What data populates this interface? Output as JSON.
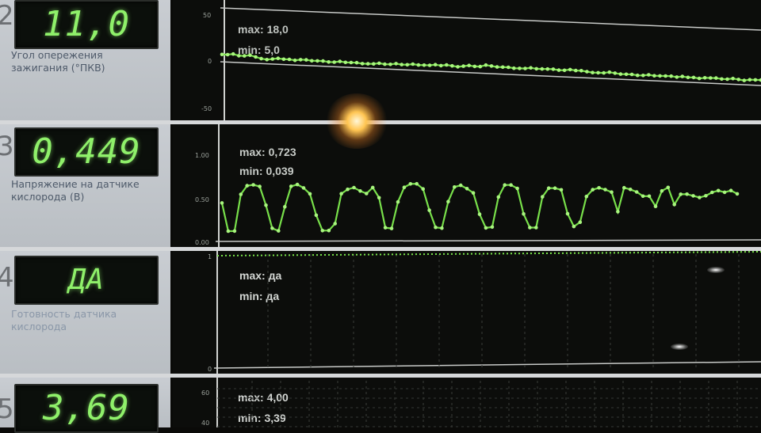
{
  "colors": {
    "trace": "#78e04a",
    "lcd": "#8ff06a",
    "panel_bg": "#0c0d0b",
    "sidebar_bg": "#c3c7cc"
  },
  "rows": [
    {
      "number": "2",
      "lcd_value": "11,0",
      "label_line1": "Угол опережения",
      "label_line2": "зажигания (°ПКВ)",
      "max_text": "max: 18,0",
      "min_text": "min: 5,0",
      "y_ticks": [
        "50",
        "0",
        "-50"
      ],
      "chart_data": {
        "type": "line",
        "ylim": [
          -60,
          60
        ],
        "values": [
          10,
          10,
          11,
          9,
          9,
          10,
          8,
          6,
          5,
          6,
          7,
          6,
          6,
          5,
          6,
          6,
          5,
          5,
          5,
          4,
          4,
          5,
          4,
          4,
          4,
          3,
          3,
          3,
          4,
          3,
          3,
          4,
          3,
          3,
          4,
          3,
          3,
          3,
          4,
          3,
          4,
          3,
          2,
          3,
          4,
          3,
          3,
          5,
          4,
          3,
          3,
          3,
          2,
          2,
          2,
          3,
          2,
          2,
          2,
          2,
          1,
          1,
          2,
          1,
          1,
          0,
          -1,
          -1,
          -1,
          0,
          -1,
          -2,
          -2,
          -2,
          -3,
          -3,
          -2,
          -3,
          -3,
          -3,
          -3,
          -4,
          -3,
          -4,
          -4,
          -5,
          -4,
          -4,
          -4,
          -5,
          -5,
          -4,
          -5,
          -6,
          -5,
          -5,
          -5
        ]
      }
    },
    {
      "number": "3",
      "lcd_value": "0,449",
      "label_line1": "Напряжение на датчике",
      "label_line2": "кислорода (В)",
      "max_text": "max: 0,723",
      "min_text": "min: 0,039",
      "y_ticks": [
        "1.00",
        "0.50",
        "0.00"
      ],
      "chart_data": {
        "type": "line",
        "ylim": [
          0,
          1
        ],
        "values": [
          0.45,
          0.12,
          0.12,
          0.55,
          0.65,
          0.66,
          0.64,
          0.42,
          0.15,
          0.12,
          0.4,
          0.64,
          0.66,
          0.62,
          0.55,
          0.3,
          0.12,
          0.12,
          0.2,
          0.55,
          0.6,
          0.62,
          0.58,
          0.55,
          0.62,
          0.5,
          0.15,
          0.14,
          0.45,
          0.62,
          0.66,
          0.66,
          0.6,
          0.35,
          0.15,
          0.14,
          0.45,
          0.62,
          0.64,
          0.6,
          0.55,
          0.3,
          0.14,
          0.15,
          0.5,
          0.64,
          0.64,
          0.6,
          0.3,
          0.14,
          0.14,
          0.5,
          0.6,
          0.6,
          0.58,
          0.3,
          0.15,
          0.2,
          0.5,
          0.58,
          0.6,
          0.58,
          0.55,
          0.32,
          0.6,
          0.58,
          0.55,
          0.5,
          0.5,
          0.38,
          0.56,
          0.6,
          0.4,
          0.52,
          0.52,
          0.5,
          0.48,
          0.5,
          0.54,
          0.56,
          0.54,
          0.56,
          0.52
        ]
      }
    },
    {
      "number": "4",
      "lcd_value": "ДА",
      "label_line1": "Готовность датчика",
      "label_line2": "кислорода",
      "max_text": "max: да",
      "min_text": "min: да",
      "y_ticks": [
        "1",
        "0"
      ],
      "chart_data": {
        "type": "line",
        "ylim": [
          0,
          1
        ],
        "values": [
          1,
          1
        ]
      }
    },
    {
      "number": "5",
      "lcd_value": "3,69",
      "label_line1": "",
      "label_line2": "",
      "max_text": "max: 4,00",
      "min_text": "min: 3,39",
      "y_ticks": [
        "60",
        "40"
      ],
      "chart_data": {
        "type": "line",
        "ylim": [
          0,
          60
        ],
        "values": []
      }
    }
  ]
}
